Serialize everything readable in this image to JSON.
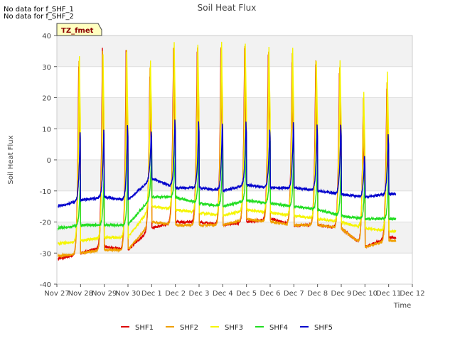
{
  "notes": [
    "No data for f_SHF_1",
    "No data for f_SHF_2"
  ],
  "badge": "TZ_fmet",
  "chart_data": {
    "type": "line",
    "title": "Soil Heat Flux",
    "xlabel": "Time",
    "ylabel": "Soil Heat Flux",
    "ylim": [
      -40,
      40
    ],
    "yticks": [
      -40,
      -30,
      -20,
      -10,
      0,
      10,
      20,
      30,
      40
    ],
    "xlim": [
      0,
      15
    ],
    "xtick_labels": [
      "Nov 27",
      "Nov 28",
      "Nov 29",
      "Nov 30",
      "Dec 1",
      "Dec 2",
      "Dec 3",
      "Dec 4",
      "Dec 5",
      "Dec 6",
      "Dec 7",
      "Dec 8",
      "Dec 9",
      "Dec 10",
      "Dec 11",
      "Dec 12"
    ],
    "grid": true,
    "legend_position": "bottom",
    "colors": {
      "SHF1": "#dd0000",
      "SHF2": "#f0a000",
      "SHF3": "#f5f500",
      "SHF4": "#22dd22",
      "SHF5": "#0000cc"
    },
    "series_meta": {
      "SHF1": {
        "peak_time": 0.92,
        "rise_hours": 0.08,
        "decay_hours": 0.2
      },
      "SHF2": {
        "peak_time": 0.93,
        "rise_hours": 0.08,
        "decay_hours": 0.2
      },
      "SHF3": {
        "peak_time": 0.95,
        "rise_hours": 0.09,
        "decay_hours": 0.22
      },
      "SHF4": {
        "peak_time": 1.04,
        "rise_hours": 0.14,
        "decay_hours": 0.28
      },
      "SHF5": {
        "peak_time": 0.98,
        "rise_hours": 0.12,
        "decay_hours": 0.26
      }
    },
    "series": [
      {
        "name": "SHF1",
        "peaks": [
          30,
          36,
          35,
          27,
          36,
          35,
          36,
          36,
          34,
          31,
          31,
          28,
          14,
          23
        ],
        "mins": [
          -32,
          -30,
          -28,
          -29,
          -22,
          -20,
          -20,
          -21,
          -20,
          -19,
          -21,
          -21,
          -22,
          -28,
          -25
        ]
      },
      {
        "name": "SHF2",
        "peaks": [
          32,
          35,
          35,
          30,
          36,
          36,
          36,
          37,
          35,
          34,
          32,
          30,
          20,
          25
        ],
        "mins": [
          -31,
          -30,
          -29,
          -29,
          -20,
          -21,
          -21,
          -21,
          -19,
          -20,
          -21,
          -21,
          -22,
          -28,
          -26
        ]
      },
      {
        "name": "SHF3",
        "peaks": [
          33,
          34,
          35,
          32,
          38,
          37,
          38,
          37,
          36,
          36,
          32,
          32,
          22,
          28
        ],
        "mins": [
          -27,
          -26,
          -25,
          -25,
          -15,
          -16,
          -17,
          -18,
          -16,
          -17,
          -18,
          -19,
          -20,
          -22,
          -23
        ]
      },
      {
        "name": "SHF4",
        "peaks": [
          21,
          24,
          26,
          22,
          24,
          29,
          29,
          28,
          27,
          26,
          21,
          22,
          13,
          18
        ],
        "mins": [
          -22,
          -21,
          -21,
          -21,
          -12,
          -12,
          -14,
          -15,
          -13,
          -14,
          -15,
          -16,
          -18,
          -19,
          -19
        ]
      },
      {
        "name": "SHF5",
        "peaks": [
          9,
          10,
          11,
          9,
          13,
          12,
          12,
          12,
          10,
          12,
          11,
          11,
          1,
          8
        ],
        "mins": [
          -15,
          -13,
          -12,
          -13,
          -6,
          -9,
          -9,
          -10,
          -8,
          -9,
          -9,
          -10,
          -11,
          -12,
          -11
        ]
      }
    ]
  }
}
